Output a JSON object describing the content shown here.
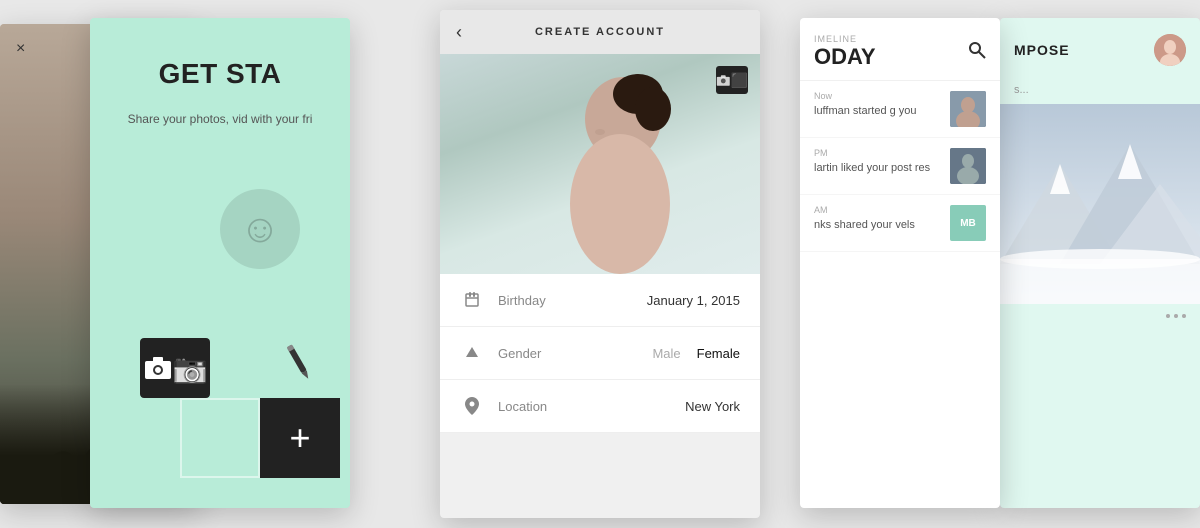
{
  "cards": {
    "farLeft": {
      "closeLabel": "×"
    },
    "left": {
      "title": "GET STA",
      "subtitle": "Share your photos, vid\nwith your fri"
    },
    "center": {
      "backLabel": "‹",
      "title": "CREATE ACCOUNT",
      "cameraIconLabel": "camera",
      "fields": [
        {
          "icon": "birthday-icon",
          "label": "Birthday",
          "value": "January 1, 2015"
        },
        {
          "icon": "gender-icon",
          "label": "Gender",
          "options": [
            "Male",
            "Female"
          ],
          "selectedOption": "Female"
        },
        {
          "icon": "location-icon",
          "label": "Location",
          "value": "New York"
        }
      ]
    },
    "right": {
      "timelineLabel": "IMELINE",
      "timelineDay": "ODAY",
      "searchIconLabel": "search",
      "items": [
        {
          "time": "Now",
          "text": "luffman started\ng you",
          "hasAvatar": true,
          "avatarType": "photo1"
        },
        {
          "time": "PM",
          "text": "lartin liked your post\nres",
          "hasAvatar": true,
          "avatarType": "photo2"
        },
        {
          "time": "AM",
          "text": "nks shared your\nvels",
          "hasAvatar": true,
          "avatarType": "mb",
          "avatarInitials": "MB"
        }
      ]
    },
    "farRight": {
      "title": "MPOSE",
      "inputPlaceholder": "s...",
      "dotsCount": 3
    }
  },
  "layout": {
    "backgroundColor": "#d8d8d8"
  }
}
